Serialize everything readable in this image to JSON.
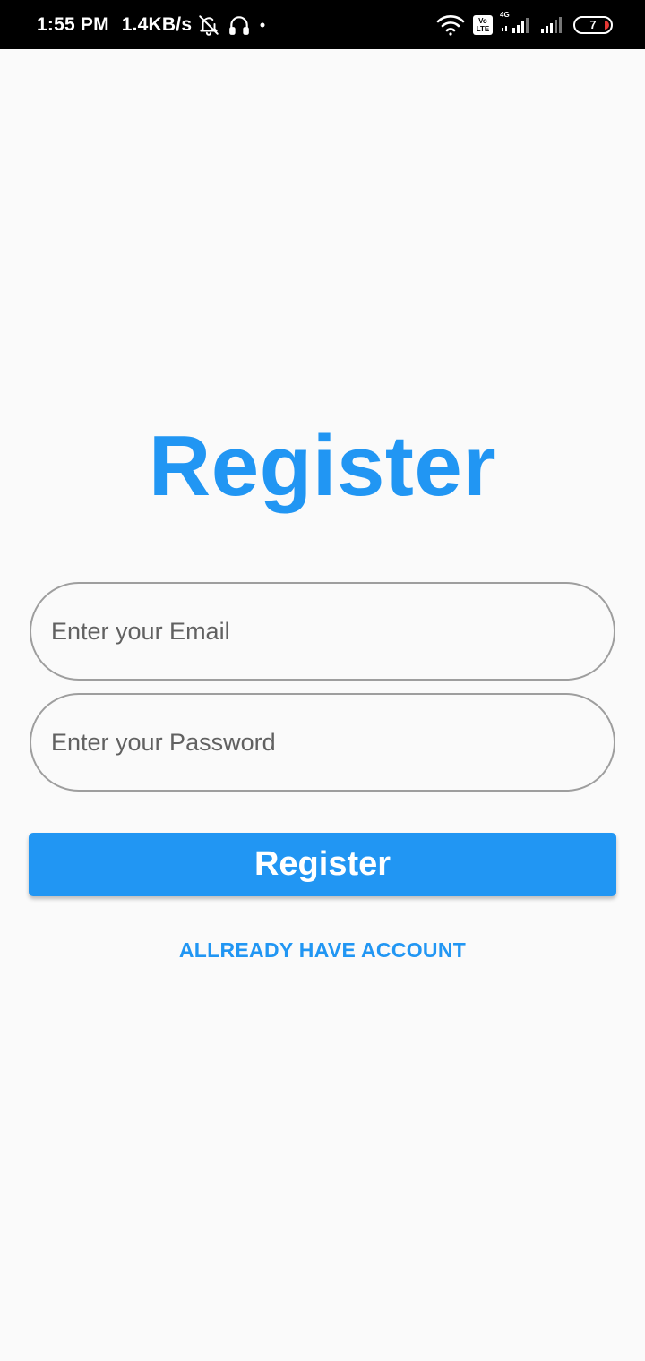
{
  "status_bar": {
    "time": "1:55 PM",
    "net_speed": "1.4KB/s",
    "icons": [
      "bell-off-icon",
      "headphones-icon",
      "dot-icon",
      "wifi-icon",
      "volte-icon",
      "signal-4g-icon",
      "signal-icon",
      "battery-icon"
    ],
    "volte_line1": "Vo",
    "volte_line2": "LTE",
    "network_type": "4G",
    "battery_level": "7",
    "battery_color": "#e53935"
  },
  "screen": {
    "title": "Register",
    "email_placeholder": "Enter your Email",
    "email_value": "",
    "password_placeholder": "Enter your Password",
    "password_value": "",
    "register_button": "Register",
    "account_link": "ALLREADY HAVE ACCOUNT"
  },
  "colors": {
    "accent": "#2196f3",
    "background": "#fafafa",
    "field_border": "#9e9e9e"
  }
}
